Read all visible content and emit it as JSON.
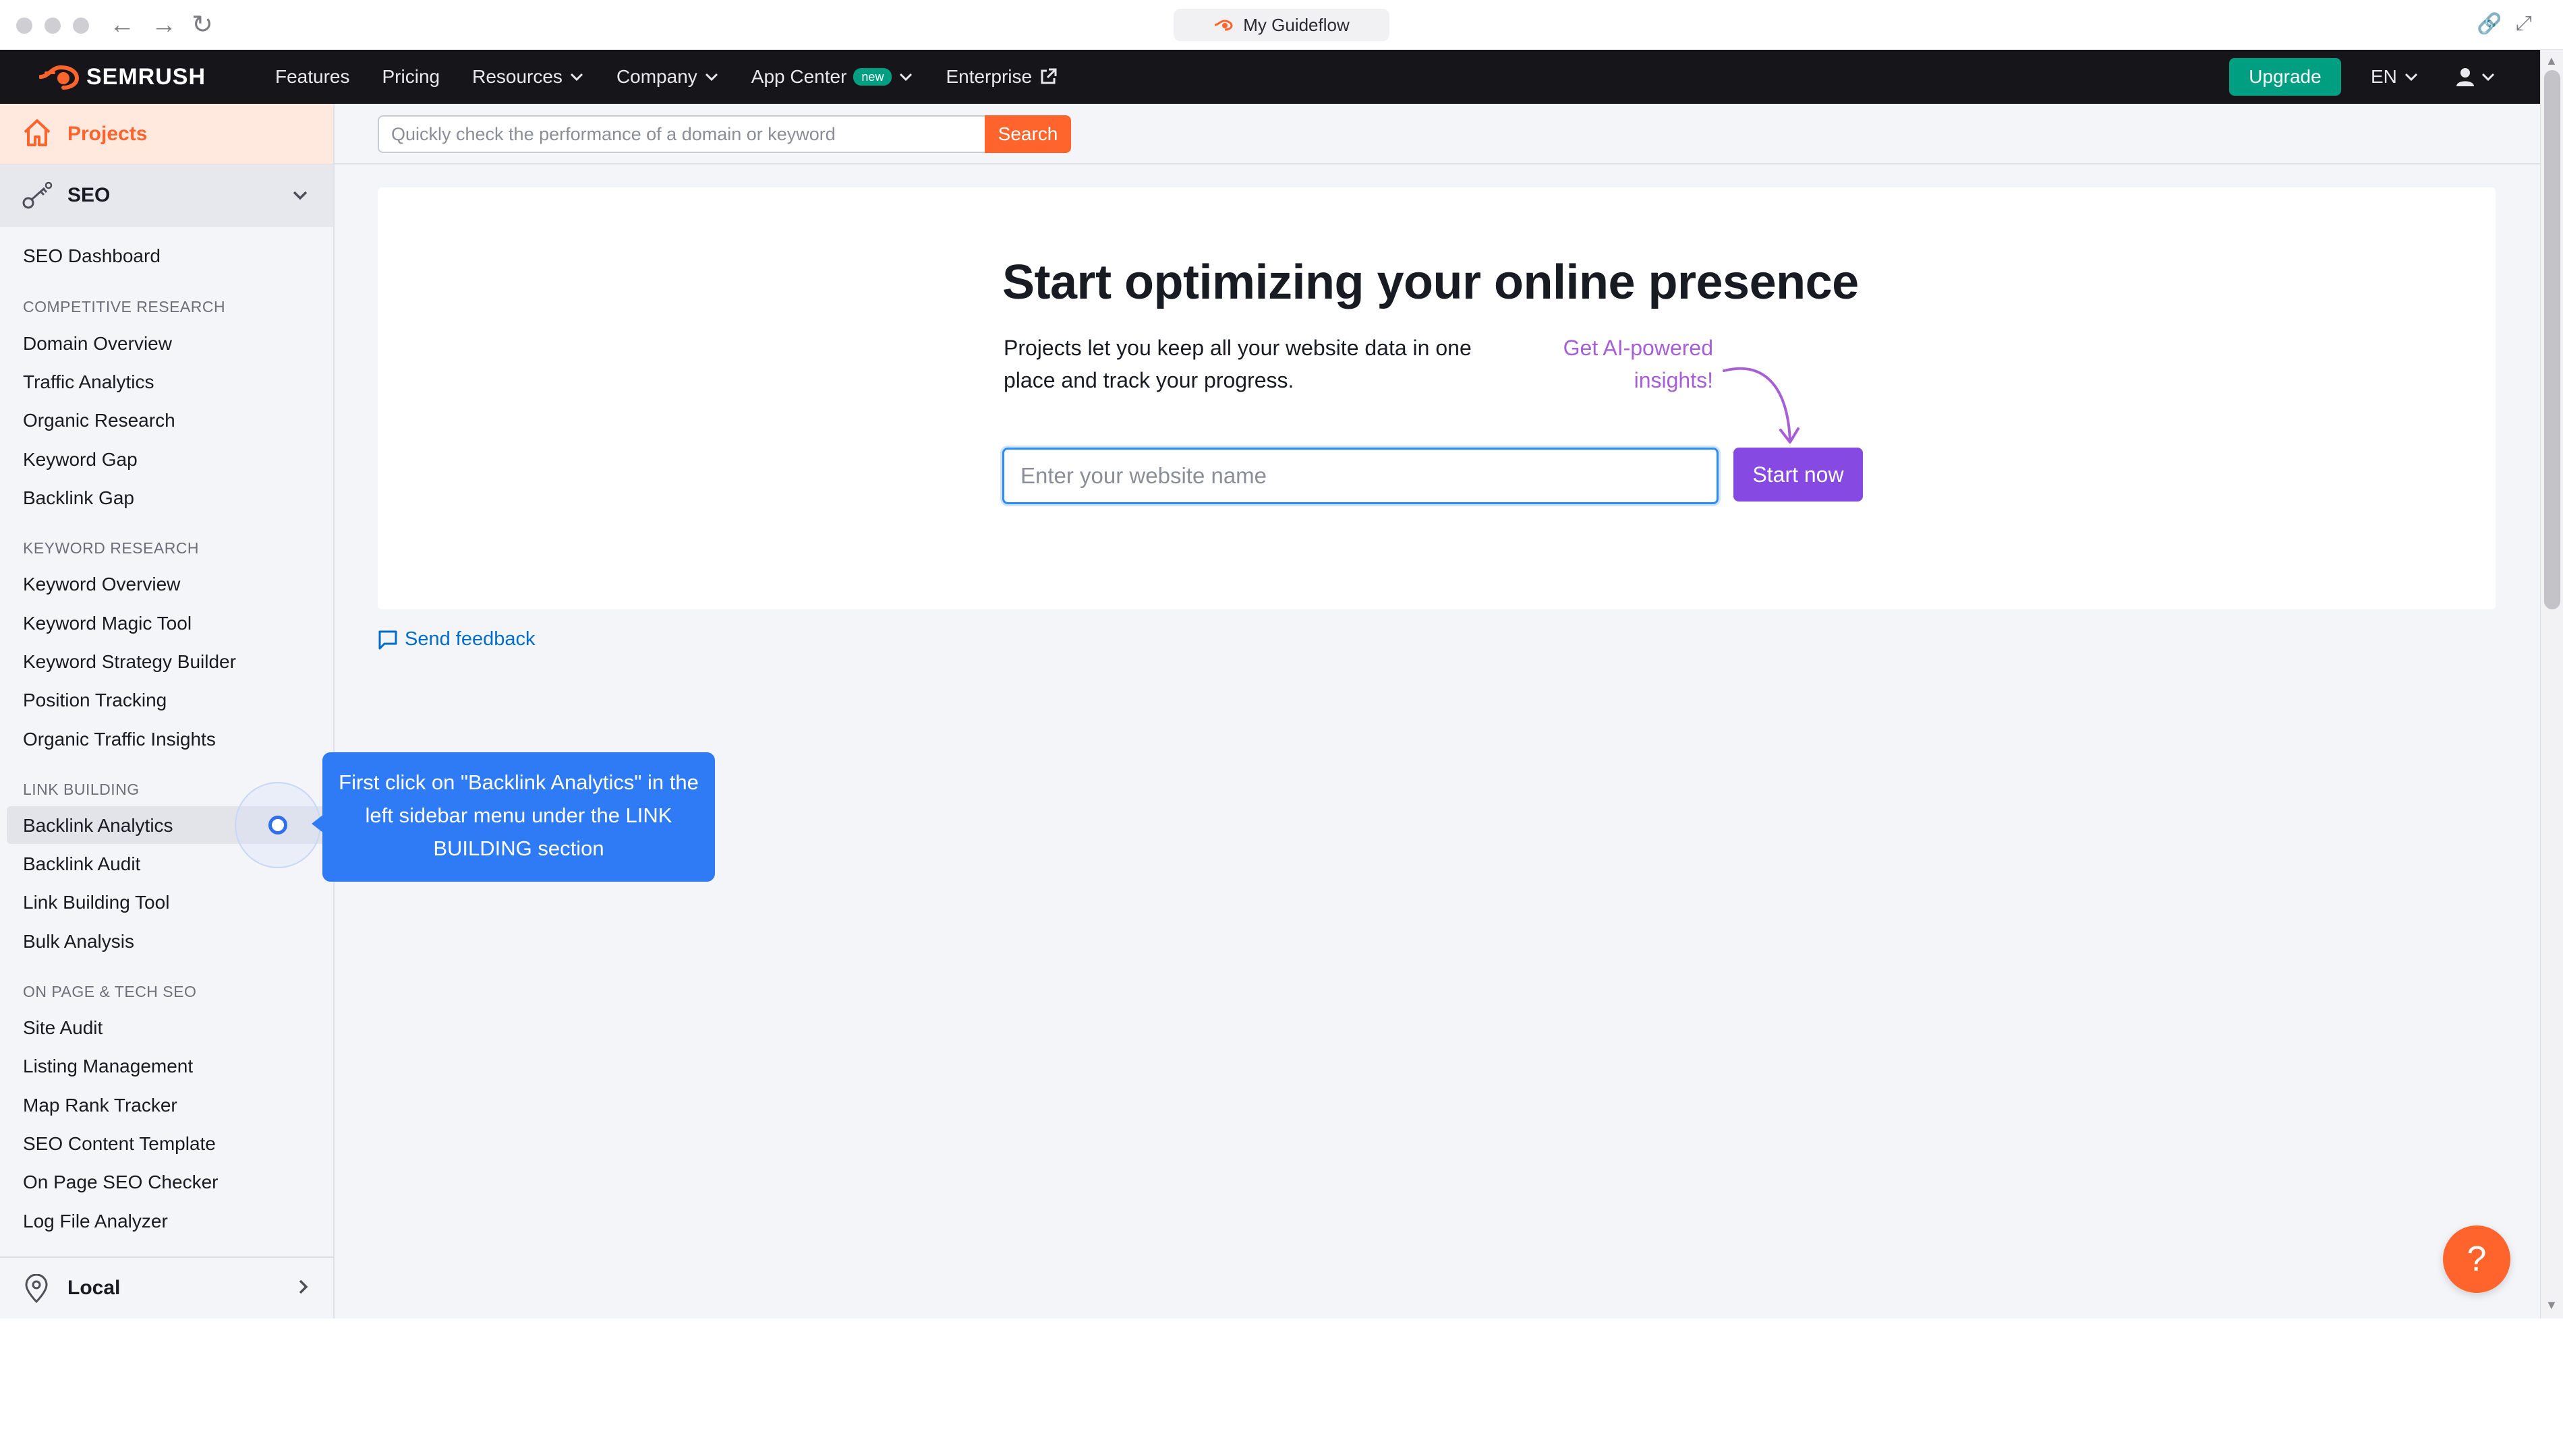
{
  "browser": {
    "tab_title": "My Guideflow"
  },
  "topnav": {
    "logo_text": "SEMRUSH",
    "items": [
      {
        "label": "Features",
        "dropdown": false
      },
      {
        "label": "Pricing",
        "dropdown": false
      },
      {
        "label": "Resources",
        "dropdown": true
      },
      {
        "label": "Company",
        "dropdown": true
      },
      {
        "label": "App Center",
        "dropdown": true,
        "badge": "new"
      },
      {
        "label": "Enterprise",
        "external": true
      }
    ],
    "upgrade_label": "Upgrade",
    "language": "EN"
  },
  "sidebar": {
    "projects_label": "Projects",
    "seo_label": "SEO",
    "seo_dashboard": "SEO Dashboard",
    "sections": [
      {
        "title": "COMPETITIVE RESEARCH",
        "items": [
          "Domain Overview",
          "Traffic Analytics",
          "Organic Research",
          "Keyword Gap",
          "Backlink Gap"
        ]
      },
      {
        "title": "KEYWORD RESEARCH",
        "items": [
          "Keyword Overview",
          "Keyword Magic Tool",
          "Keyword Strategy Builder",
          "Position Tracking",
          "Organic Traffic Insights"
        ]
      },
      {
        "title": "LINK BUILDING",
        "items": [
          "Backlink Analytics",
          "Backlink Audit",
          "Link Building Tool",
          "Bulk Analysis"
        ]
      },
      {
        "title": "ON PAGE & TECH SEO",
        "items": [
          "Site Audit",
          "Listing Management",
          "Map Rank Tracker",
          "SEO Content Template",
          "On Page SEO Checker",
          "Log File Analyzer"
        ]
      }
    ],
    "local_label": "Local"
  },
  "search": {
    "placeholder": "Quickly check the performance of a domain or keyword",
    "button_label": "Search"
  },
  "hero": {
    "title": "Start optimizing your online presence",
    "description": "Projects let you keep all your website data in one place and track your progress.",
    "ai_note": "Get AI-powered insights!",
    "input_placeholder": "Enter your website name",
    "start_label": "Start now"
  },
  "feedback_label": "Send feedback",
  "help_label": "?",
  "guide": {
    "tooltip": "First click on \"Backlink Analytics\" in the left sidebar menu under the LINK BUILDING section"
  },
  "colors": {
    "brand_orange": "#ff642d",
    "nav_bg": "#16161a",
    "upgrade_green": "#009f81",
    "start_purple": "#8649e1",
    "ai_purple": "#a75fd8",
    "tooltip_blue": "#2f7bf5",
    "link_blue": "#006dca"
  }
}
